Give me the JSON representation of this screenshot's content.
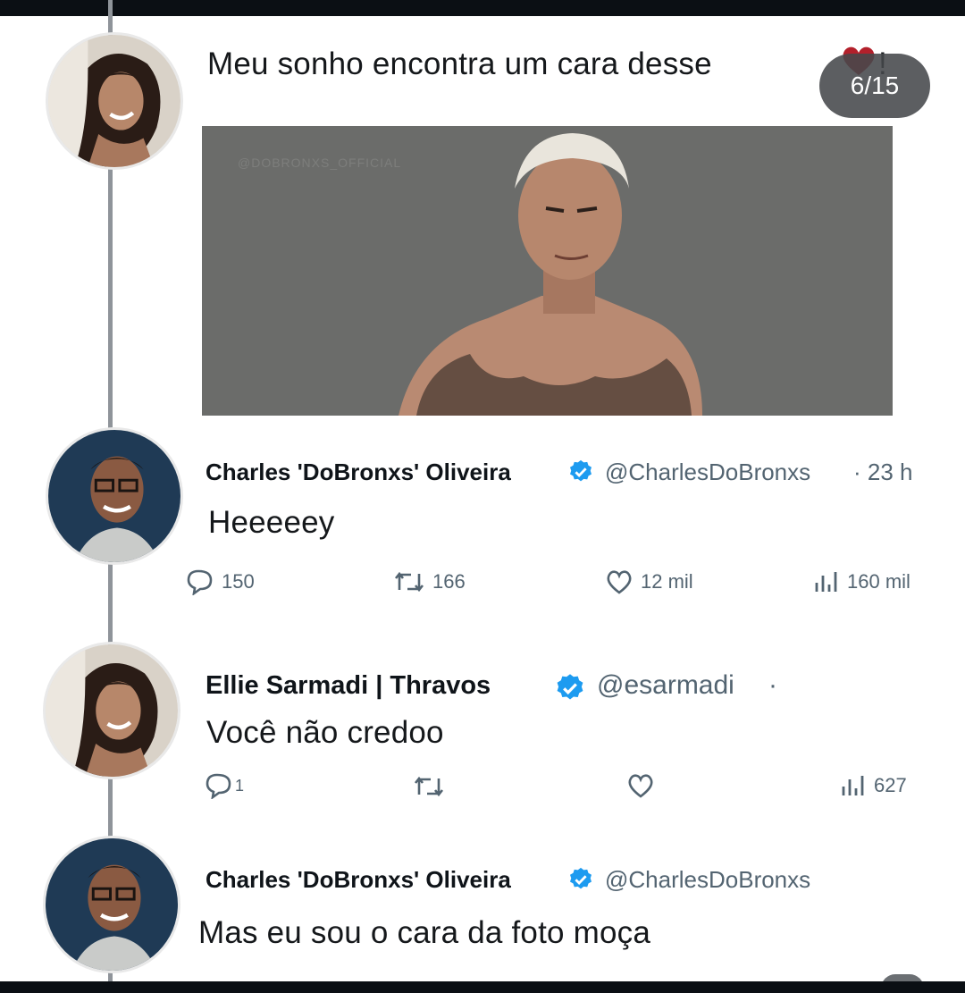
{
  "counter": "6/15",
  "post": {
    "text": "Meu sonho encontra um cara desse",
    "text_tail": "!",
    "photo_watermark": "@DOBRONXS_OFFICIAL"
  },
  "replies": [
    {
      "name": "Charles 'DoBronxs' Oliveira",
      "handle": "@CharlesDoBronxs",
      "time": "· 23 h",
      "text": "Heeeeey",
      "actions": {
        "replies": "150",
        "retweets": "166",
        "likes": "12 mil",
        "views": "160 mil"
      }
    },
    {
      "name": "Ellie Sarmadi | Thravos",
      "handle": "@esarmadi",
      "time": "·",
      "text": "Você não credoo",
      "actions": {
        "replies": "1",
        "retweets": "",
        "likes": "",
        "views": "627"
      }
    },
    {
      "name": "Charles 'DoBronxs' Oliveira",
      "handle": "@CharlesDoBronxs",
      "text": "Mas eu sou o cara da foto moça"
    }
  ],
  "icons": {
    "reply": "reply-icon",
    "retweet": "retweet-icon",
    "like": "heart-icon",
    "views": "views-icon",
    "verified": "verified-badge-icon"
  },
  "colors": {
    "verified": "#1d9bf0",
    "heart_emoji": "#b3202b",
    "muted": "#536471"
  }
}
